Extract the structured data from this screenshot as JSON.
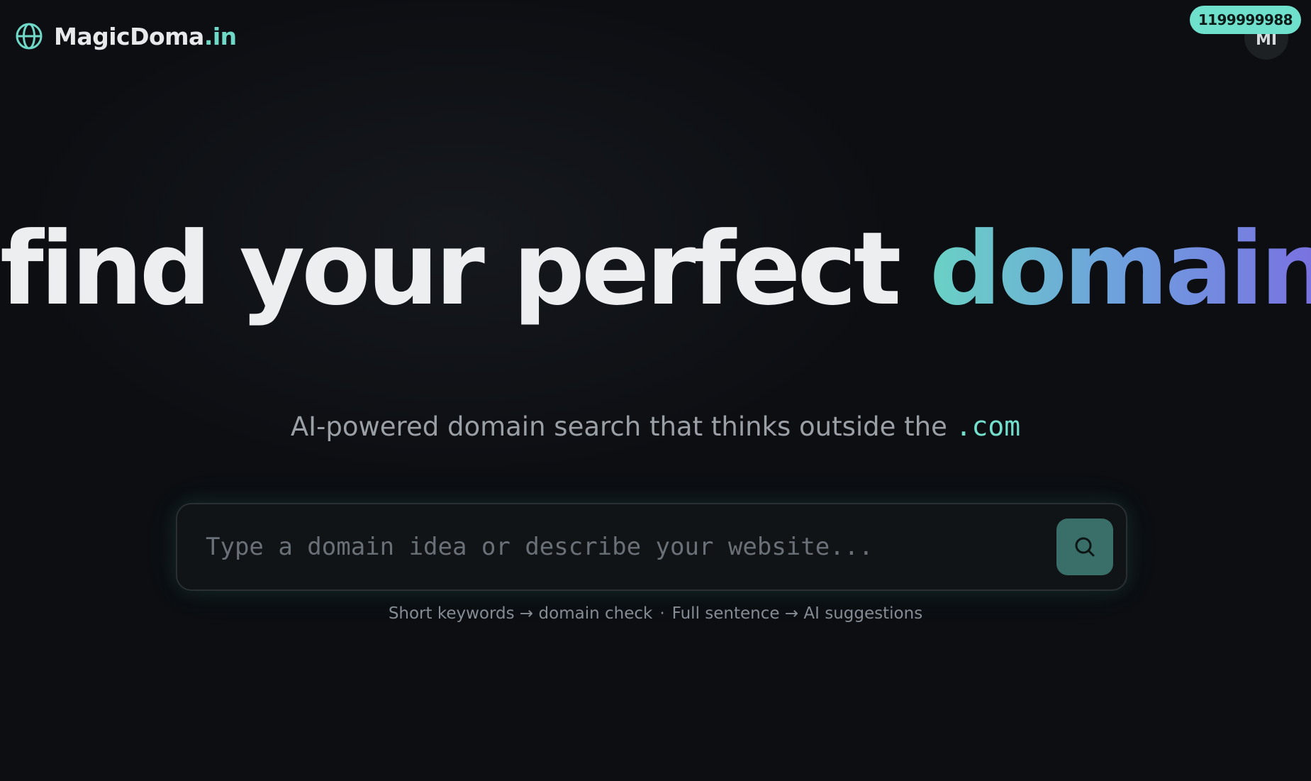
{
  "header": {
    "logo_icon": "globe-icon",
    "logo_text_main": "MagicDoma",
    "logo_text_accent": ".in",
    "avatar_initials": "MI",
    "badge_value": "1199999988"
  },
  "hero": {
    "title_main": "find your perfect ",
    "title_accent": "domain",
    "subtitle_main": "AI-powered domain search that thinks outside the ",
    "subtitle_accent": ".com"
  },
  "search": {
    "placeholder": "Type a domain idea or describe your website...",
    "value": "",
    "button_icon": "search-icon"
  },
  "hint": {
    "left": "Short keywords → domain check",
    "separator": "·",
    "right": "Full sentence → AI suggestions"
  },
  "colors": {
    "background": "#0c0e12",
    "accent_teal": "#6fd8c6",
    "accent_purple": "#7a6ee0",
    "search_button": "#3a6e68",
    "badge": "#6fe0cc"
  }
}
